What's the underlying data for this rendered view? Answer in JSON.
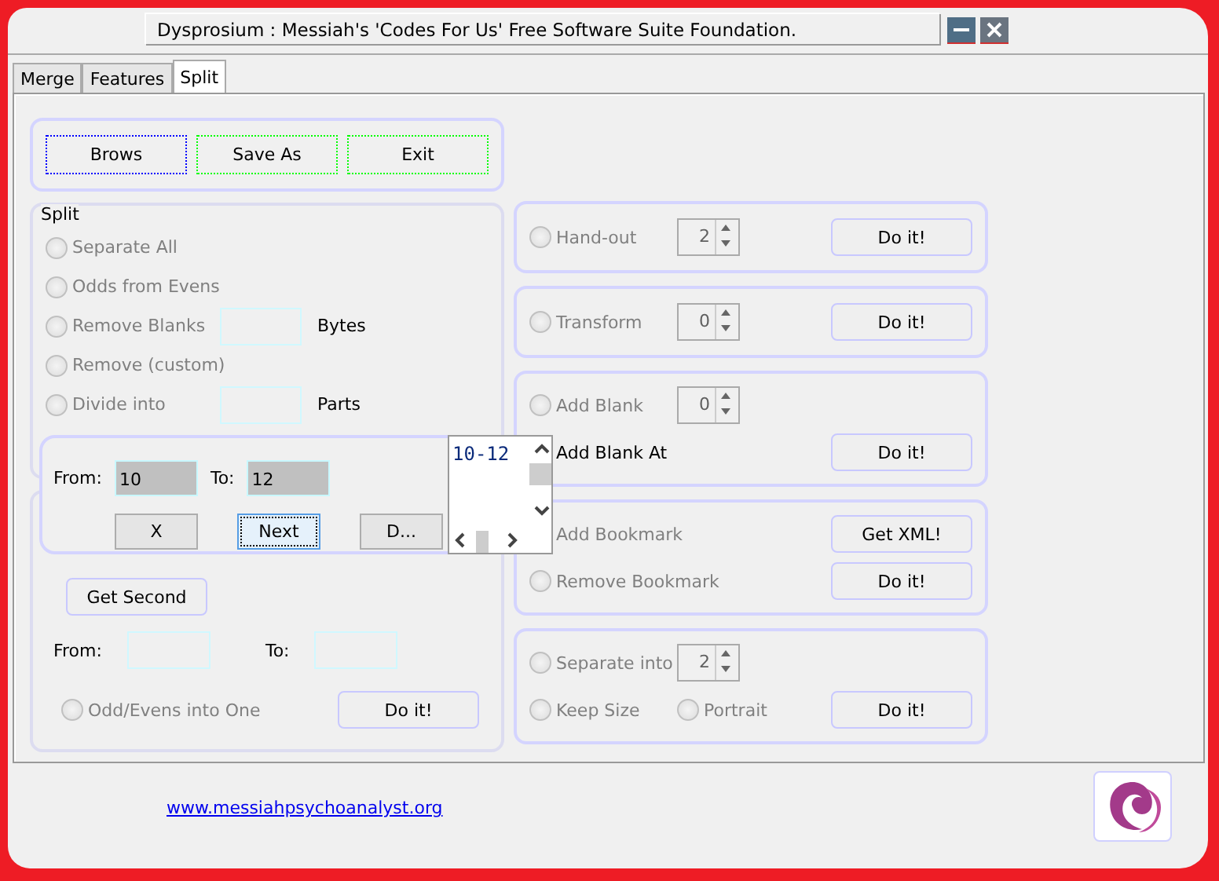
{
  "window": {
    "title": "Dysprosium : Messiah's 'Codes For Us' Free Software Suite Foundation."
  },
  "tabs": [
    {
      "label": "Merge",
      "selected": false
    },
    {
      "label": "Features",
      "selected": false
    },
    {
      "label": "Split",
      "selected": true
    }
  ],
  "top_buttons": [
    {
      "label": "Brows",
      "color": "#0000ff"
    },
    {
      "label": "Save As",
      "color": "#00ff00"
    },
    {
      "label": "Exit",
      "color": "#00ff00"
    }
  ],
  "split_group": {
    "title": "Split",
    "options": [
      {
        "label": "Separate All",
        "disabled": true,
        "selected": false
      },
      {
        "label": "Odds from Evens",
        "disabled": true,
        "selected": false
      },
      {
        "label": "Remove Blanks",
        "disabled": true,
        "selected": false,
        "unit": "Bytes"
      },
      {
        "label": "Remove (custom)",
        "disabled": true,
        "selected": false
      },
      {
        "label": "Divide into",
        "disabled": true,
        "selected": false,
        "unit": "Parts"
      }
    ]
  },
  "range_group": {
    "get_button": "Get Second",
    "from_label": "From:",
    "to_label": "To:",
    "option": {
      "label": "Odd/Evens into One",
      "disabled": true,
      "selected": false
    },
    "button": "Do it!"
  },
  "popup": {
    "from_label": "From:",
    "from_value": "10",
    "to_label": "To:",
    "to_value": "12",
    "buttons": [
      {
        "label": "X",
        "selected": false
      },
      {
        "label": "Next",
        "selected": true
      },
      {
        "label": "D...",
        "selected": false
      }
    ],
    "list_items": [
      "10-12"
    ]
  },
  "right_panels": [
    {
      "rows": [
        [
          {
            "kind": "radio",
            "label": "Hand-out",
            "disabled": true,
            "selected": false
          },
          {
            "kind": "spinner",
            "value": "2"
          },
          {
            "kind": "button",
            "label": "Do it!"
          }
        ]
      ]
    },
    {
      "rows": [
        [
          {
            "kind": "radio",
            "label": "Transform",
            "disabled": true,
            "selected": false
          },
          {
            "kind": "spinner",
            "value": "0"
          },
          {
            "kind": "button",
            "label": "Do it!"
          }
        ]
      ]
    },
    {
      "rows": [
        [
          {
            "kind": "radio",
            "label": "Add Blank",
            "disabled": true,
            "selected": false
          },
          {
            "kind": "spinner",
            "value": "0"
          }
        ],
        [
          {
            "kind": "radio",
            "label": "Add Blank At",
            "disabled": false
          },
          {
            "kind": "button",
            "label": "Do it!"
          }
        ]
      ]
    },
    {
      "rows": [
        [
          {
            "kind": "radio",
            "label": "Add Bookmark",
            "disabled": true
          },
          {
            "kind": "button",
            "label": "Get XML!"
          }
        ],
        [
          {
            "kind": "radio",
            "label": "Remove Bookmark",
            "disabled": true,
            "selected": false
          },
          {
            "kind": "button",
            "label": "Do it!"
          }
        ]
      ]
    },
    {
      "rows": [
        [
          {
            "kind": "radio",
            "label": "Separate into",
            "disabled": true,
            "selected": false
          },
          {
            "kind": "spinner",
            "value": "2"
          }
        ],
        [
          {
            "kind": "radio",
            "label": "Keep Size",
            "disabled": true,
            "selected": false
          },
          {
            "kind": "radio",
            "label": "Portrait",
            "disabled": true,
            "selected": false
          },
          {
            "kind": "button",
            "label": "Do it!"
          }
        ]
      ]
    }
  ],
  "footer": {
    "link": "www.messiahpsychoanalyst.org"
  }
}
